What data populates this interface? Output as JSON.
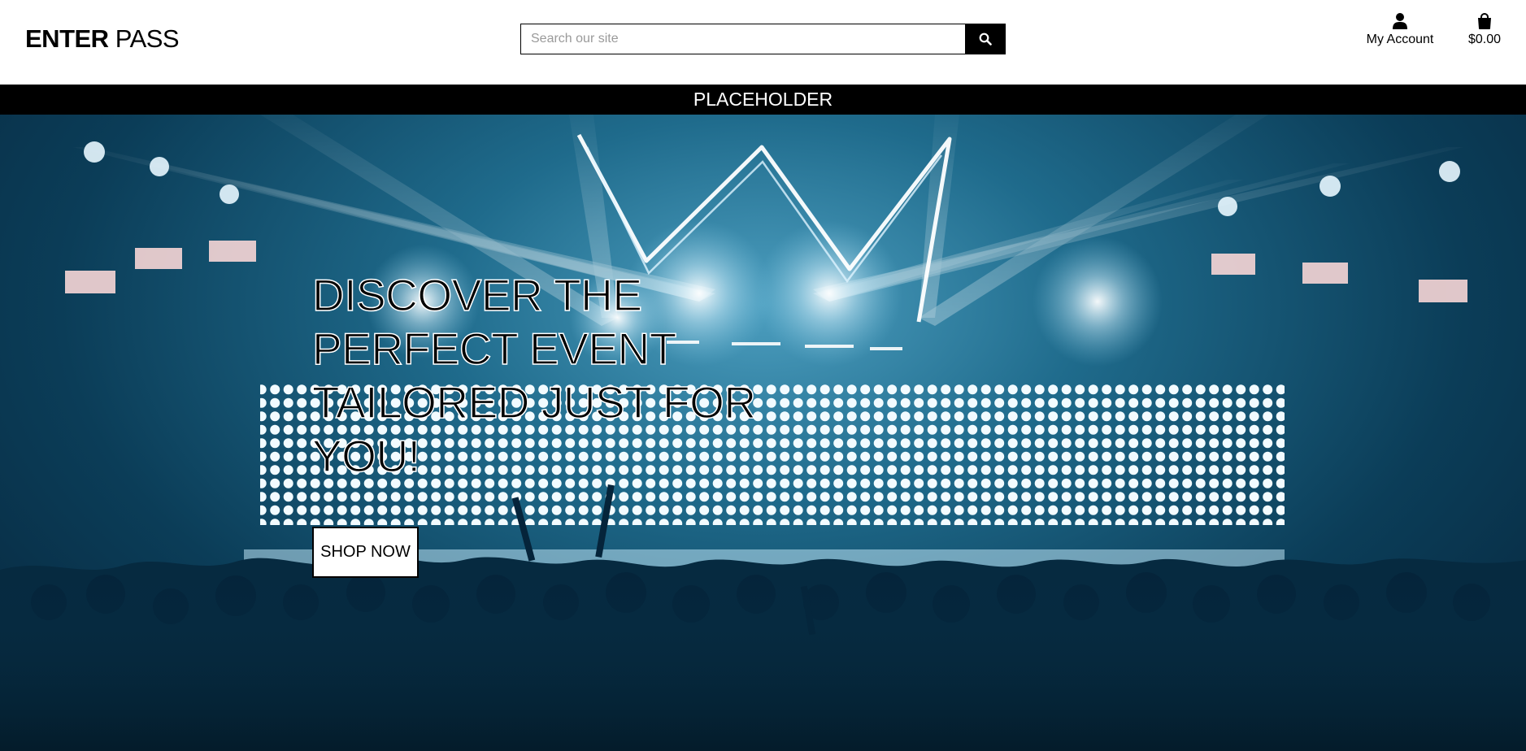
{
  "header": {
    "logo_bold": "ENTER",
    "logo_light": "PASS",
    "search": {
      "placeholder": "Search our site"
    },
    "account_label": "My Account",
    "bag_total": "$0.00"
  },
  "banner": {
    "text": "PLACEHOLDER"
  },
  "hero": {
    "title": "DISCOVER THE PERFECT EVENT TAILORED JUST FOR YOU!",
    "cta_label": "SHOP NOW"
  },
  "icons": {
    "search": "search-icon",
    "account": "user-icon",
    "bag": "shopping-bag-icon"
  },
  "colors": {
    "header_bg": "#ffffff",
    "banner_bg": "#000000",
    "hero_tint": "#1f6b8c"
  }
}
